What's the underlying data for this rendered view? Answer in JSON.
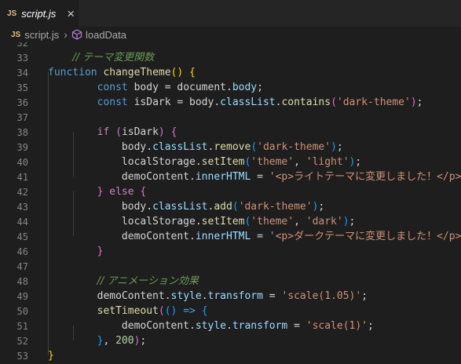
{
  "tab": {
    "badge": "JS",
    "label": "script.js",
    "close": "×"
  },
  "breadcrumb": {
    "badge": "JS",
    "file": "script.js",
    "separator": "›",
    "symbol": "loadData"
  },
  "lines": [
    {
      "n": "32",
      "t": []
    },
    {
      "n": "33",
      "t": [
        [
          "    ",
          ""
        ],
        [
          "// テーマ変更関数",
          "cmt"
        ]
      ]
    },
    {
      "n": "34",
      "t": [
        [
          "function",
          "kw"
        ],
        [
          " ",
          ""
        ],
        [
          "changeTheme",
          "fn"
        ],
        [
          "()",
          "br1"
        ],
        [
          " ",
          ""
        ],
        [
          "{",
          "br1"
        ]
      ]
    },
    {
      "n": "35",
      "t": [
        [
          "        ",
          ""
        ],
        [
          "const",
          "kw"
        ],
        [
          " body = document.",
          ""
        ],
        [
          "body",
          "var"
        ],
        [
          ";",
          ""
        ]
      ]
    },
    {
      "n": "36",
      "t": [
        [
          "        ",
          ""
        ],
        [
          "const",
          "kw"
        ],
        [
          " isDark = body.",
          ""
        ],
        [
          "classList",
          "var"
        ],
        [
          ".",
          ""
        ],
        [
          "contains",
          "fn"
        ],
        [
          "(",
          "br2"
        ],
        [
          "'dark-theme'",
          "str"
        ],
        [
          ")",
          "br2"
        ],
        [
          ";",
          ""
        ]
      ]
    },
    {
      "n": "37",
      "t": []
    },
    {
      "n": "38",
      "t": [
        [
          "        ",
          ""
        ],
        [
          "if",
          "ctl"
        ],
        [
          " ",
          ""
        ],
        [
          "(",
          "br2"
        ],
        [
          "isDark",
          ""
        ],
        [
          ")",
          "br2"
        ],
        [
          " ",
          ""
        ],
        [
          "{",
          "br2"
        ]
      ]
    },
    {
      "n": "39",
      "t": [
        [
          "            body.",
          ""
        ],
        [
          "classList",
          "var"
        ],
        [
          ".",
          ""
        ],
        [
          "remove",
          "fn"
        ],
        [
          "(",
          "br3"
        ],
        [
          "'dark-theme'",
          "str"
        ],
        [
          ")",
          "br3"
        ],
        [
          ";",
          ""
        ]
      ]
    },
    {
      "n": "40",
      "t": [
        [
          "            localStorage.",
          ""
        ],
        [
          "setItem",
          "fn"
        ],
        [
          "(",
          "br3"
        ],
        [
          "'theme'",
          "str"
        ],
        [
          ", ",
          ""
        ],
        [
          "'light'",
          "str"
        ],
        [
          ")",
          "br3"
        ],
        [
          ";",
          ""
        ]
      ]
    },
    {
      "n": "41",
      "t": [
        [
          "            demoContent.",
          ""
        ],
        [
          "innerHTML",
          "var"
        ],
        [
          " = ",
          ""
        ],
        [
          "'<p>ライトテーマに変更しました！</p>'",
          "str"
        ],
        [
          ";",
          ""
        ]
      ]
    },
    {
      "n": "42",
      "t": [
        [
          "        ",
          ""
        ],
        [
          "}",
          "br2"
        ],
        [
          " ",
          ""
        ],
        [
          "else",
          "ctl"
        ],
        [
          " ",
          ""
        ],
        [
          "{",
          "br2"
        ]
      ]
    },
    {
      "n": "43",
      "t": [
        [
          "            body.",
          ""
        ],
        [
          "classList",
          "var"
        ],
        [
          ".",
          ""
        ],
        [
          "add",
          "fn"
        ],
        [
          "(",
          "br3"
        ],
        [
          "'dark-theme'",
          "str"
        ],
        [
          ")",
          "br3"
        ],
        [
          ";",
          ""
        ]
      ]
    },
    {
      "n": "44",
      "t": [
        [
          "            localStorage.",
          ""
        ],
        [
          "setItem",
          "fn"
        ],
        [
          "(",
          "br3"
        ],
        [
          "'theme'",
          "str"
        ],
        [
          ", ",
          ""
        ],
        [
          "'dark'",
          "str"
        ],
        [
          ")",
          "br3"
        ],
        [
          ";",
          ""
        ]
      ]
    },
    {
      "n": "45",
      "t": [
        [
          "            demoContent.",
          ""
        ],
        [
          "innerHTML",
          "var"
        ],
        [
          " = ",
          ""
        ],
        [
          "'<p>ダークテーマに変更しました！</p>'",
          "str"
        ],
        [
          ";",
          ""
        ]
      ]
    },
    {
      "n": "46",
      "t": [
        [
          "        ",
          ""
        ],
        [
          "}",
          "br2"
        ]
      ]
    },
    {
      "n": "47",
      "t": []
    },
    {
      "n": "48",
      "t": [
        [
          "        ",
          ""
        ],
        [
          "// アニメーション効果",
          "cmt"
        ]
      ]
    },
    {
      "n": "49",
      "t": [
        [
          "        demoContent.",
          ""
        ],
        [
          "style",
          "var"
        ],
        [
          ".",
          ""
        ],
        [
          "transform",
          "var"
        ],
        [
          " = ",
          ""
        ],
        [
          "'scale(1.05)'",
          "str"
        ],
        [
          ";",
          ""
        ]
      ]
    },
    {
      "n": "50",
      "t": [
        [
          "        ",
          ""
        ],
        [
          "setTimeout",
          "fn"
        ],
        [
          "(",
          "br2"
        ],
        [
          "()",
          "br3"
        ],
        [
          " ",
          ""
        ],
        [
          "=>",
          "kw"
        ],
        [
          " ",
          ""
        ],
        [
          "{",
          "br3"
        ]
      ]
    },
    {
      "n": "51",
      "t": [
        [
          "            demoContent.",
          ""
        ],
        [
          "style",
          "var"
        ],
        [
          ".",
          ""
        ],
        [
          "transform",
          "var"
        ],
        [
          " = ",
          ""
        ],
        [
          "'scale(1)'",
          "str"
        ],
        [
          ";",
          ""
        ]
      ]
    },
    {
      "n": "52",
      "t": [
        [
          "        ",
          ""
        ],
        [
          "}",
          "br3"
        ],
        [
          ", ",
          ""
        ],
        [
          "200",
          "num"
        ],
        [
          ")",
          "br2"
        ],
        [
          ";",
          ""
        ]
      ]
    },
    {
      "n": "53",
      "t": [
        [
          "}",
          "br1"
        ]
      ]
    }
  ]
}
